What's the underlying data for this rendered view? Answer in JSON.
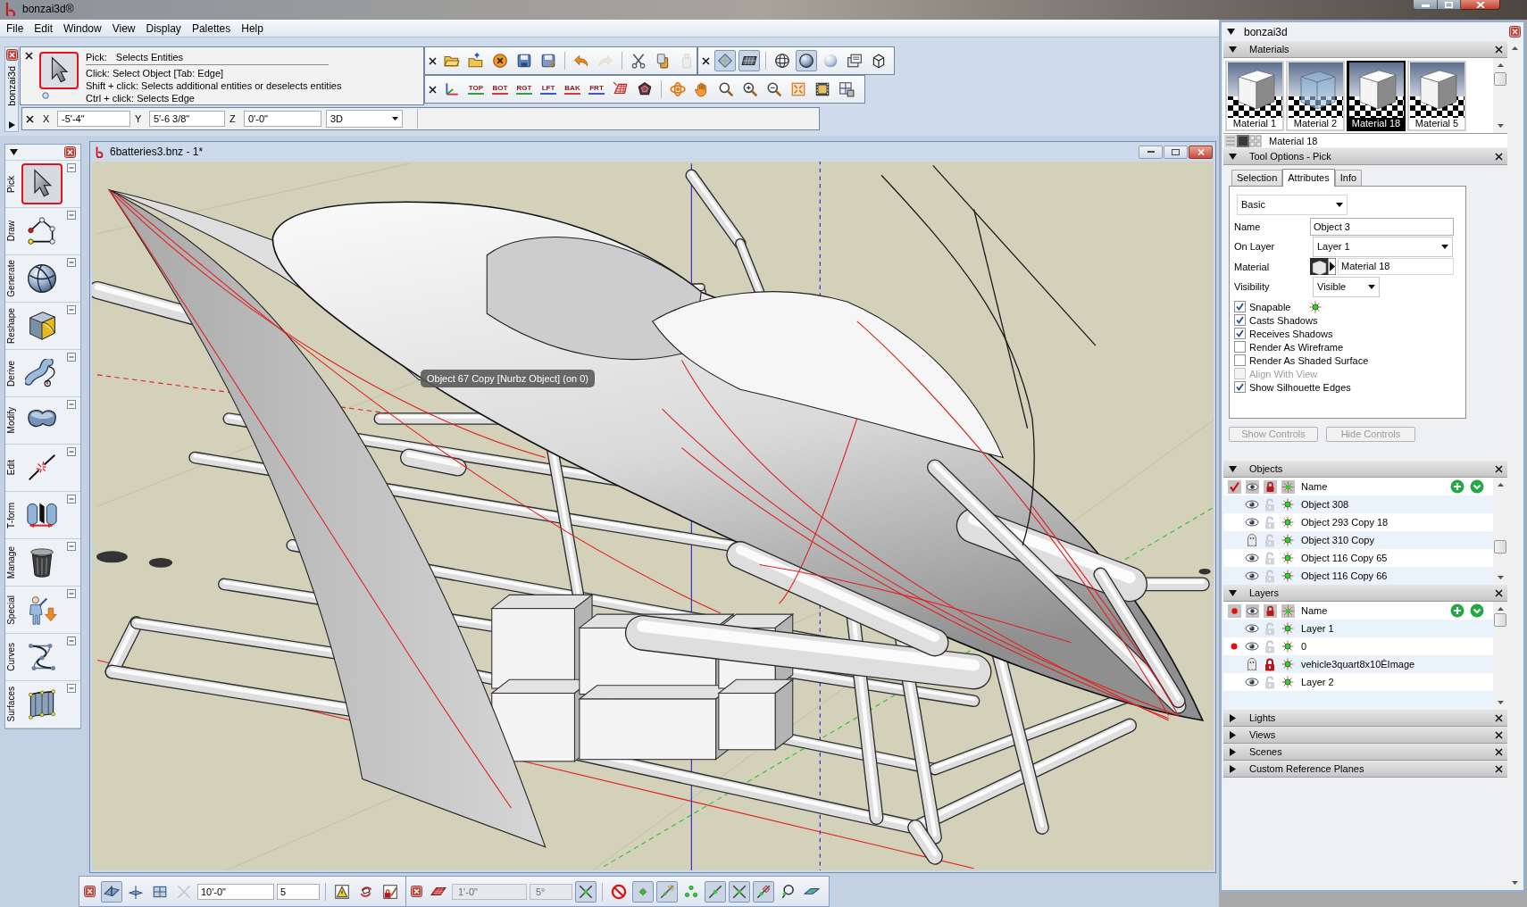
{
  "window": {
    "title": "bonzai3d®"
  },
  "menu": [
    "File",
    "Edit",
    "Window",
    "View",
    "Display",
    "Palettes",
    "Help"
  ],
  "dock": {
    "title": "bonzai3d"
  },
  "pick_panel": {
    "tool": "Pick:",
    "summary": "Selects Entities",
    "hints": [
      "Click: Select Object [Tab: Edge]",
      "Shift + click: Selects additional entities or deselects entities",
      "Ctrl + click: Selects Edge"
    ]
  },
  "file_toolbar": [
    {
      "disabled": false
    },
    {
      "disabled": false
    },
    {
      "disabled": false
    },
    {
      "disabled": false
    },
    {
      "disabled": false
    },
    {
      "disabled": false
    },
    {
      "disabled": true
    },
    {
      "disabled": false
    },
    {
      "disabled": false
    },
    {
      "disabled": true
    }
  ],
  "display_toolbar": [
    {
      "pressed": true
    },
    {
      "pressed": true
    },
    {
      "pressed": false
    },
    {
      "pressed": true
    },
    {
      "pressed": false
    },
    {
      "pressed": false
    },
    {
      "pressed": false
    }
  ],
  "view_toolbar": {
    "views": [
      {
        "label": "TOP",
        "color": "#35a040"
      },
      {
        "label": "BOT",
        "color": "#d83a3a"
      },
      {
        "label": "RGT",
        "color": "#35a040"
      },
      {
        "label": "LFT",
        "color": "#3a58d0"
      },
      {
        "label": "BAK",
        "color": "#d83a3a"
      },
      {
        "label": "FRT",
        "color": "#3a58d0"
      }
    ]
  },
  "coordinates": {
    "fields": [
      {
        "label": "X",
        "value": "-5'-4\""
      },
      {
        "label": "Y",
        "value": "5'-6 3/8\""
      },
      {
        "label": "Z",
        "value": "0'-0\""
      }
    ],
    "mode": "3D"
  },
  "tool_palette": {
    "items": [
      {
        "label": "Pick",
        "selected": true
      },
      {
        "label": "Draw",
        "selected": false
      },
      {
        "label": "Generate",
        "selected": false
      },
      {
        "label": "Reshape",
        "selected": false
      },
      {
        "label": "Derive",
        "selected": false
      },
      {
        "label": "Modify",
        "selected": false
      },
      {
        "label": "Edit",
        "selected": false
      },
      {
        "label": "T-form",
        "selected": false
      },
      {
        "label": "Manage",
        "selected": false
      },
      {
        "label": "Special",
        "selected": false
      },
      {
        "label": "Curves",
        "selected": false
      },
      {
        "label": "Surfaces",
        "selected": false
      }
    ]
  },
  "document": {
    "title": "6batteries3.bnz - 1*",
    "tooltip": "Object 67 Copy [Nurbz Object] (on 0)"
  },
  "plane_toolbar": {
    "buttons": [
      {
        "pressed": true,
        "disabled": false
      },
      {
        "pressed": false,
        "disabled": false
      },
      {
        "pressed": false,
        "disabled": false
      },
      {
        "pressed": false,
        "disabled": true
      },
      {
        "pressed": false,
        "disabled": false
      },
      {
        "pressed": false,
        "disabled": false
      },
      {
        "pressed": false,
        "disabled": false
      }
    ],
    "fields": [
      "10'-0\"",
      "5"
    ]
  },
  "snap_toolbar": {
    "fields": [
      {
        "value": "1'-0\"",
        "disabled": true
      },
      {
        "value": "5°",
        "disabled": true
      }
    ],
    "buttons": [
      {
        "pressed": false
      },
      {
        "pressed": true
      },
      {
        "pressed": false
      },
      {
        "pressed": true
      },
      {
        "pressed": true
      },
      {
        "pressed": false
      },
      {
        "pressed": true
      },
      {
        "pressed": true
      },
      {
        "pressed": true
      },
      {
        "pressed": false
      },
      {
        "pressed": false
      }
    ]
  },
  "palette_window": {
    "title": "bonzai3d"
  },
  "materials": {
    "title": "Materials",
    "expanded": true,
    "items": [
      {
        "name": "Material 1",
        "kind": "solid",
        "selected": false
      },
      {
        "name": "Material 2",
        "kind": "glass",
        "selected": false
      },
      {
        "name": "Material 18",
        "kind": "solid",
        "selected": true
      },
      {
        "name": "Material 5",
        "kind": "solid",
        "selected": false
      }
    ],
    "current": "Material 18"
  },
  "tool_options": {
    "title": "Tool Options - Pick",
    "expanded": true,
    "tabs": [
      {
        "label": "Selection",
        "selected": false
      },
      {
        "label": "Attributes",
        "selected": true
      },
      {
        "label": "Info",
        "selected": false
      }
    ],
    "preset": "Basic",
    "fields": [
      {
        "kind": "text",
        "label": "Name",
        "value": "Object 3"
      },
      {
        "kind": "dropdown",
        "label": "On Layer",
        "value": "Layer 1"
      },
      {
        "kind": "material",
        "label": "Material",
        "value": "Material 18"
      },
      {
        "kind": "dropdown",
        "label": "Visibility",
        "value": "Visible"
      }
    ],
    "options": [
      {
        "label": "Snapable",
        "checked": true,
        "disabled": false
      },
      {
        "label": "Casts Shadows",
        "checked": true,
        "disabled": false
      },
      {
        "label": "Receives Shadows",
        "checked": true,
        "disabled": false
      },
      {
        "label": "Render As Wireframe",
        "checked": false,
        "disabled": false
      },
      {
        "label": "Render As Shaded Surface",
        "checked": false,
        "disabled": false
      },
      {
        "label": "Align With View",
        "checked": false,
        "disabled": true
      },
      {
        "label": "Show Silhouette Edges",
        "checked": true,
        "disabled": false
      }
    ],
    "buttons": [
      {
        "label": "Show Controls",
        "disabled": true
      },
      {
        "label": "Hide Controls",
        "disabled": true
      }
    ]
  },
  "objects": {
    "title": "Objects",
    "expanded": true,
    "column": "Name",
    "rows": [
      {
        "name": "Object 308",
        "visible": true,
        "locked": false
      },
      {
        "name": "Object 293 Copy 18",
        "visible": true,
        "locked": false
      },
      {
        "name": "Object 310 Copy",
        "visible": false,
        "locked": false
      },
      {
        "name": "Object 116 Copy 65",
        "visible": true,
        "locked": false
      },
      {
        "name": "Object 116 Copy 66",
        "visible": true,
        "locked": false
      }
    ]
  },
  "layers": {
    "title": "Layers",
    "expanded": true,
    "column": "Name",
    "rows": [
      {
        "name": "Layer 1",
        "active": false,
        "visible": true,
        "locked": false
      },
      {
        "name": "0",
        "active": true,
        "visible": true,
        "locked": false
      },
      {
        "name": "vehicle3quart8x10ÊImage",
        "active": false,
        "visible": false,
        "locked": true
      },
      {
        "name": "Layer 2",
        "active": false,
        "visible": true,
        "locked": false
      }
    ]
  },
  "sections": [
    {
      "title": "Lights",
      "expanded": false
    },
    {
      "title": "Views",
      "expanded": false
    },
    {
      "title": "Scenes",
      "expanded": false
    },
    {
      "title": "Custom Reference Planes",
      "expanded": false
    }
  ]
}
